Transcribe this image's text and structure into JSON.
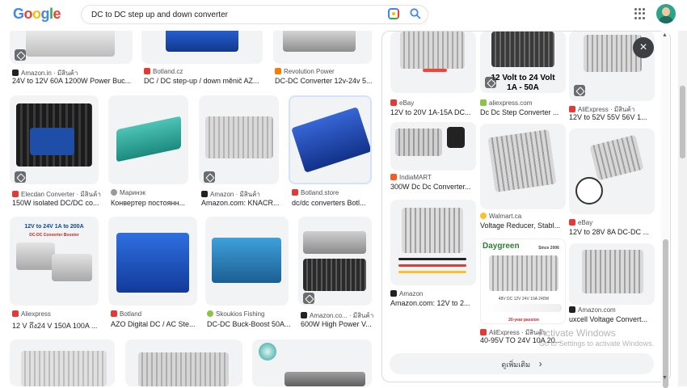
{
  "header": {
    "logo": "Google",
    "search_value": "DC to DC step up and down converter"
  },
  "colors": {
    "blue": "#4285f4",
    "red": "#ea4335",
    "yellow": "#fbbc05",
    "green": "#34a853"
  },
  "results": [
    {
      "source": "Amazon.in · มีสินค้า",
      "title": "24V to 12V 60A 1200W Power Buc..."
    },
    {
      "source": "Botland.cz",
      "title": "DC / DC step-up / down měnič AZ..."
    },
    {
      "source": "Revolution Power",
      "title": "DC-DC Converter 12v-24v 5..."
    },
    {
      "source": "Elecdan Converter · มีสินค้า",
      "title": "150W isolated DC/DC co..."
    },
    {
      "source": "Маринэк",
      "title": "Конвертер постоянн..."
    },
    {
      "source": "Amazon · มีสินค้า",
      "title": "Amazon.com: KNACR..."
    },
    {
      "source": "Botland.store",
      "title": "dc/dc converters Botl..."
    },
    {
      "source": "Aliexpress",
      "title": "12 V ถึง24 V 150A 100A ..."
    },
    {
      "source": "Botland",
      "title": "AZO Digital DC / AC Ste..."
    },
    {
      "source": "Skoukios Fishing",
      "title": "DC-DC Buck-Boost 50A..."
    },
    {
      "source": "Amazon.co... · มีสินค้า",
      "title": "600W High Power V..."
    }
  ],
  "image_labels": {
    "aliexpress_thumb": "12V to 24V 1A to 200A",
    "aliexpress_thumb_sub": "DC-DC Converter Booster"
  },
  "panel": {
    "related": [
      {
        "source": "eBay",
        "title": "12V to 20V 1A-15A DC..."
      },
      {
        "source": "aliexpress.com",
        "title": "Dc Dc Step Converter ..."
      },
      {
        "source": "AliExpress · มีสินค้า",
        "title": "12V to 52V 55V 56V 1..."
      },
      {
        "source": "IndiaMART",
        "title": "300W Dc Dc Converter..."
      },
      {
        "source": "Walmart.ca",
        "title": "Voltage Reducer, Stabl..."
      },
      {
        "source": "eBay",
        "title": "12V to 28V 8A DC-DC ..."
      },
      {
        "source": "Amazon",
        "title": "Amazon.com: 12V to 2..."
      },
      {
        "source": "Amazon.com",
        "title": "uxcell Voltage Convert..."
      },
      {
        "source": "AliExpress · มีสินค้า",
        "title": "40-95V TO 24V 10A 20..."
      }
    ],
    "overlay_1": "12 Volt to 24 Volt",
    "overlay_2": "1A - 50A",
    "daygreen": "Daygreen",
    "since": "Since 2006",
    "passion": "20-year passion",
    "ratings": "48V DC 12V 24V 10A 240W",
    "more_label": "ดูเพิ่มเติม",
    "close_glyph": "×",
    "more_chevron": "›"
  },
  "watermark": {
    "line1": "Activate Windows",
    "line2": "Go to Settings to activate Windows."
  }
}
